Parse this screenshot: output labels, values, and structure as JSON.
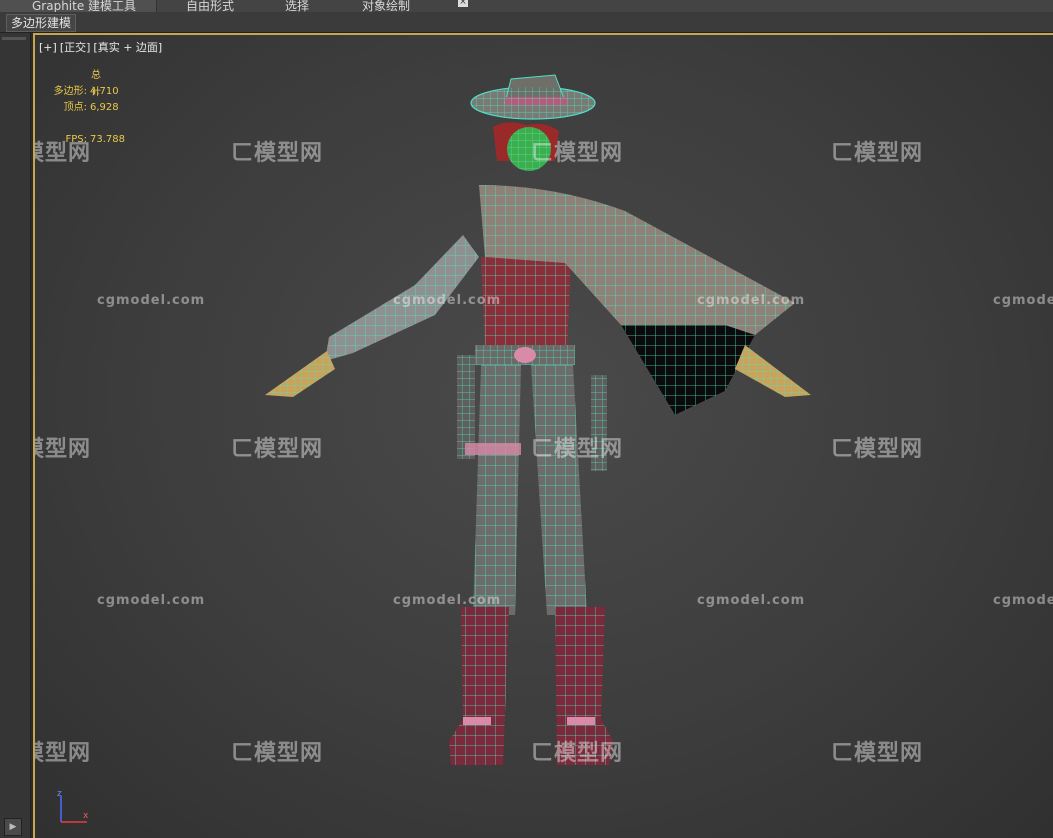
{
  "ribbon": {
    "tabs": [
      "Graphite 建模工具",
      "自由形式",
      "选择",
      "对象绘制"
    ]
  },
  "subbar": {
    "panel_label": "多边形建模"
  },
  "viewport": {
    "label_parts": [
      "[+]",
      "[正交]",
      "[真实 + 边面]"
    ],
    "stats": {
      "header": "总计",
      "polys_label": "多边形:",
      "polys_value": "4,710",
      "verts_label": "顶点:",
      "verts_value": "6,928",
      "fps_label": "FPS:",
      "fps_value": "73.788"
    },
    "axis": {
      "x": "x",
      "z": "z"
    }
  },
  "watermark": {
    "brand": "模型网",
    "site": "cgmodel.com"
  },
  "colors": {
    "viewport_border": "#c8a64a",
    "wire": "#4fe0c8",
    "stats_text": "#e9c84a"
  }
}
